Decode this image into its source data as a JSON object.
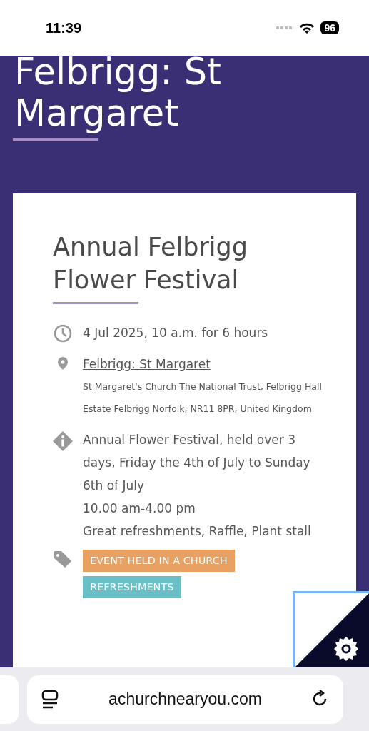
{
  "status_bar": {
    "time": "11:39",
    "battery": "96"
  },
  "page_title": "Felbrigg: St Margaret",
  "event": {
    "title": "Annual Felbrigg Flower Festival",
    "when": "4 Jul 2025, 10 a.m. for 6 hours",
    "venue_link": "Felbrigg: St Margaret",
    "address": "St Margaret's Church The National Trust, Felbrigg Hall Estate Felbrigg Norfolk, NR11 8PR, United Kingdom",
    "description": [
      "Annual Flower Festival, held over 3 days, Friday the 4th of July to Sunday 6th of July",
      "10.00 am-4.00 pm",
      "Great refreshments, Raffle, Plant stall"
    ],
    "tags": [
      {
        "label": "EVENT HELD IN A CHURCH",
        "color": "#e8a063"
      },
      {
        "label": "REFRESHMENTS",
        "color": "#6bbfc6"
      }
    ]
  },
  "address_bar": {
    "url": "achurchnearyou.com"
  }
}
